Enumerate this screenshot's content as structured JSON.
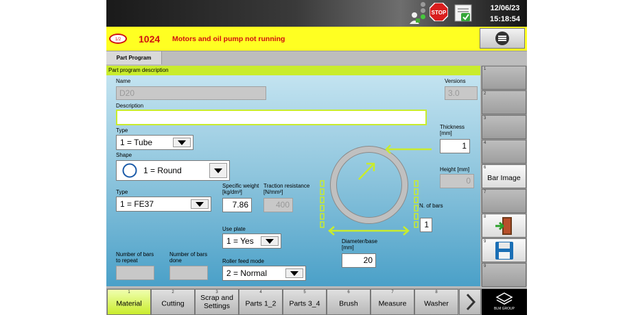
{
  "header": {
    "date": "12/06/23",
    "time": "15:18:54"
  },
  "alarm": {
    "page_indicator": "1/2",
    "code": "1024",
    "message": "Motors and oil pump not running"
  },
  "tabs": [
    {
      "label": "Part Program"
    }
  ],
  "panel": {
    "title": "Part program description",
    "name_label": "Name",
    "name_value": "D20",
    "versions_label": "Versions",
    "versions_value": "3.0",
    "description_label": "Description",
    "description_value": "",
    "type_label": "Type",
    "type_value": "1 = Tube",
    "shape_label": "Shape",
    "shape_value": "1 = Round",
    "material_type_label": "Type",
    "material_type_value": "1 = FE37",
    "specific_weight_label": "Specific weight [kg/dm³]",
    "specific_weight_value": "7.86",
    "traction_label": "Traction resistance [N/mm²]",
    "traction_value": "400",
    "use_plate_label": "Use plate",
    "use_plate_value": "1 = Yes",
    "roller_label": "Roller feed mode",
    "roller_value": "2 = Normal",
    "bars_repeat_label": "Number of bars to repeat",
    "bars_repeat_value": "",
    "bars_done_label": "Number of bars done",
    "bars_done_value": "",
    "thickness_label": "Thickness [mm]",
    "thickness_value": "1",
    "height_label": "Height [mm]",
    "height_value": "0",
    "nbars_label": "N. of bars",
    "nbars_value": "1",
    "diameter_label": "Diameter/base [mm]",
    "diameter_value": "20"
  },
  "side_buttons": [
    {
      "num": "1",
      "label": ""
    },
    {
      "num": "2",
      "label": ""
    },
    {
      "num": "3",
      "label": ""
    },
    {
      "num": "4",
      "label": ""
    },
    {
      "num": "5",
      "label": ""
    },
    {
      "num": "6",
      "label": "Bar Image"
    },
    {
      "num": "7",
      "label": ""
    },
    {
      "num": "8",
      "label": ""
    },
    {
      "num": "9",
      "label": ""
    }
  ],
  "bottom_tabs": [
    {
      "num": "1",
      "label": "Material"
    },
    {
      "num": "2",
      "label": "Cutting"
    },
    {
      "num": "3",
      "label": "Scrap and Settings"
    },
    {
      "num": "4",
      "label": "Parts 1_2"
    },
    {
      "num": "5",
      "label": "Parts 3_4"
    },
    {
      "num": "6",
      "label": "Brush"
    },
    {
      "num": "7",
      "label": "Measure"
    },
    {
      "num": "8",
      "label": "Washer"
    }
  ],
  "logo_text": "BLM GROUP",
  "colors": {
    "accent": "#c9ec2c",
    "alarm_bg": "#ffff22",
    "alarm_text": "#d01010",
    "panel_top": "#c8e6f2",
    "panel_bottom": "#4aa0c8"
  }
}
